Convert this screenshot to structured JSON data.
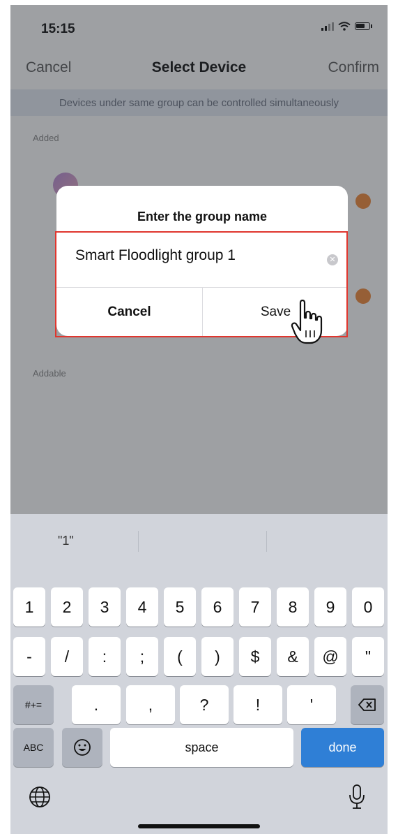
{
  "status_bar": {
    "time": "15:15",
    "icons": [
      "signal-icon",
      "wifi-icon",
      "battery-icon"
    ]
  },
  "nav": {
    "cancel_label": "Cancel",
    "title": "Select Device",
    "confirm_label": "Confirm"
  },
  "banner": {
    "text": "Devices under same group can be controlled simultaneously"
  },
  "sections": {
    "added_label": "Added",
    "addable_label": "Addable"
  },
  "dialog": {
    "title": "Enter the group name",
    "input_value": "Smart Floodlight group 1",
    "clear_icon": "clear-icon",
    "cancel_label": "Cancel",
    "save_label": "Save"
  },
  "keyboard": {
    "suggestions": [
      "\"1\"",
      "",
      ""
    ],
    "row1": [
      "1",
      "2",
      "3",
      "4",
      "5",
      "6",
      "7",
      "8",
      "9",
      "0"
    ],
    "row2": [
      "-",
      "/",
      ":",
      ";",
      "(",
      ")",
      "$",
      "&",
      "@",
      "\""
    ],
    "row3": {
      "shift_label": "#+=",
      "keys": [
        ".",
        ",",
        "?",
        "!",
        "'"
      ],
      "delete_icon": "backspace-icon"
    },
    "row4": {
      "abc_label": "ABC",
      "emoji_icon": "emoji-icon",
      "space_label": "space",
      "done_label": "done"
    },
    "globe_icon": "globe-icon",
    "mic_icon": "microphone-icon"
  },
  "colors": {
    "accent_orange": "#f0893a",
    "highlight_red": "#e0362e",
    "done_blue": "#2f7fd6"
  }
}
